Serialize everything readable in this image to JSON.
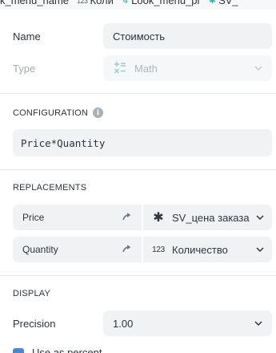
{
  "top_strip": {
    "tokens": [
      {
        "icon": "",
        "label": "k_menu_name"
      },
      {
        "icon": "123",
        "label": "Коли"
      },
      {
        "icon": "↳",
        "label": "Look_menu_pr"
      },
      {
        "icon": "✱",
        "label": "SV_"
      }
    ]
  },
  "fields": {
    "name_label": "Name",
    "name_value": "Стоимость",
    "type_label": "Type",
    "type_value": "Math",
    "type_icon": "math-icon"
  },
  "configuration": {
    "title": "CONFIGURATION",
    "expression": "Price*Quantity"
  },
  "replacements": {
    "title": "REPLACEMENTS",
    "rows": [
      {
        "source": "Price",
        "target_icon": "✱",
        "target": "SV_цена заказа"
      },
      {
        "source": "Quantity",
        "target_icon": "123",
        "target": "Количество"
      }
    ]
  },
  "display": {
    "title": "DISPLAY",
    "precision_label": "Precision",
    "precision_value": "1.00",
    "next_option_label": "Use as percent..."
  },
  "colors": {
    "accent_teal": "#2bb7a6",
    "field_bg": "#f1f2f3",
    "checkbox_blue": "#4a86d6"
  }
}
